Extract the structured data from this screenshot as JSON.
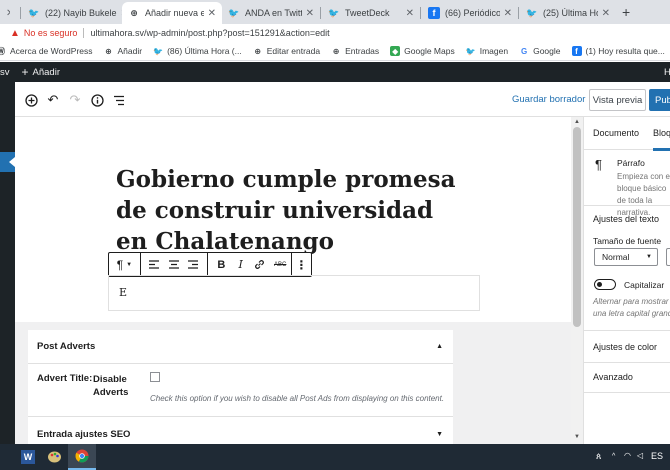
{
  "browser": {
    "tabs": [
      {
        "label": "(22) Nayib Bukele",
        "icon": "twitter-icon",
        "active": false
      },
      {
        "label": "Añadir nueva entrada",
        "icon": "wordpress-icon",
        "active": true
      },
      {
        "label": "ANDA en Twitter:",
        "icon": "twitter-icon",
        "active": false
      },
      {
        "label": "TweetDeck",
        "icon": "twitter-icon",
        "active": false
      },
      {
        "label": "(66) Periódico Digital",
        "icon": "facebook-icon",
        "active": false
      },
      {
        "label": "(25) Última Hora",
        "icon": "twitter-icon",
        "active": false
      }
    ],
    "security_label": "No es seguro",
    "url": "ultimahora.sv/wp-admin/post.php?post=151291&action=edit",
    "bookmarks": [
      {
        "label": "Acerca de WordPress",
        "icon": "wordpress-icon"
      },
      {
        "label": "Añadir",
        "icon": "wordpress-icon"
      },
      {
        "label": "(86) Última Hora (...",
        "icon": "twitter-icon"
      },
      {
        "label": "Editar entrada",
        "icon": "wordpress-icon"
      },
      {
        "label": "Entradas",
        "icon": "wordpress-icon"
      },
      {
        "label": "Google Maps",
        "icon": "maps-icon"
      },
      {
        "label": "Imagen",
        "icon": "twitter-icon"
      },
      {
        "label": "Google",
        "icon": "google-icon"
      },
      {
        "label": "(1) Hoy resulta que...",
        "icon": "facebook-icon"
      }
    ]
  },
  "adminbar": {
    "site_fragment": "sv",
    "new_label": "Añadir"
  },
  "editor": {
    "header": {
      "save_draft": "Guardar borrador",
      "preview": "Vista previa",
      "publish": "Publ"
    },
    "title": "Gobierno cumple promesa de construir universidad en Chalatenango",
    "paragraph_text": "E",
    "block_toolbar": {
      "strikethrough_label": "ABC"
    }
  },
  "metaboxes": {
    "post_adverts": {
      "heading": "Post Adverts",
      "field_label": "Advert Title:",
      "option_label": "Disable Adverts",
      "help_text": "Check this option if you wish to disable all Post Ads from displaying on this content."
    },
    "seo": {
      "heading": "Entrada ajustes SEO"
    }
  },
  "sidebar": {
    "tab_document": "Documento",
    "tab_block": "Bloque",
    "block_name": "Párrafo",
    "block_desc": "Empieza con el bloque básico de toda la narrativa.",
    "text_settings": "Ajustes del texto",
    "font_size_label": "Tamaño de fuente",
    "font_size_value": "Normal",
    "dropcap_label": "Capitalizar",
    "dropcap_help": "Alternar para mostrar una letra capital grande.",
    "color_settings": "Ajustes de color",
    "advanced": "Avanzado"
  },
  "taskbar": {
    "lang": "ES"
  },
  "colors": {
    "wp_blue": "#2271b1",
    "admin_dark": "#1d2327",
    "insecure_red": "#d93025"
  }
}
